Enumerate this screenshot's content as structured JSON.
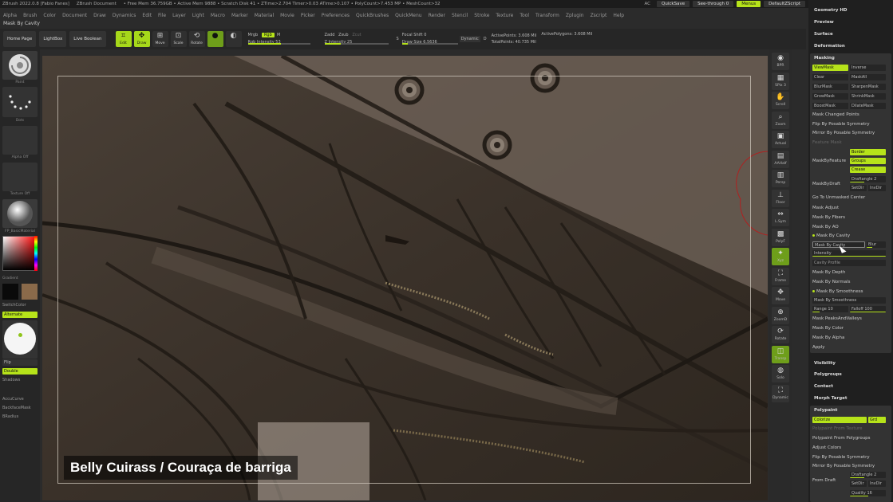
{
  "titlebar": {
    "app": "ZBrush 2022.0.8 [Fabio Fanes]",
    "doc": "ZBrush Document",
    "stats": "• Free Mem 36.759GB • Active Mem 9888 • Scratch Disk 41 • ZTime>2.704 Timer>0.03 ATime>0.107 • PolyCount>7.453 MP • MeshCount>32",
    "ac": "AC",
    "quicksave": "QuickSave",
    "seethrough": "See-through  0",
    "menus": "Menus",
    "zscript": "DefaultZScript"
  },
  "menu": [
    "Alpha",
    "Brush",
    "Color",
    "Document",
    "Draw",
    "Dynamics",
    "Edit",
    "File",
    "Layer",
    "Light",
    "Macro",
    "Marker",
    "Material",
    "Movie",
    "Picker",
    "Preferences",
    "QuickBrushes",
    "QuickMenu",
    "Render",
    "Stencil",
    "Stroke",
    "Texture",
    "Tool",
    "Transform",
    "Zplugin",
    "Zscript",
    "Help"
  ],
  "subtitle": "Mask By Cavity",
  "toolbar": {
    "home": "Home Page",
    "lightbox": "LightBox",
    "livebool": "Live Boolean",
    "edit": "Edit",
    "draw": "Draw",
    "move": "Move",
    "scale": "Scale",
    "rotate": "Rotate",
    "mrgb": "Mrgb",
    "rgb": "Rgb",
    "m": "M",
    "rgb_int": "Rgb Intensity 53",
    "zadd": "Zadd",
    "zsub": "Zsub",
    "zcut": "Zcut",
    "z_int": "Z Intensity 25",
    "focal": "Focal Shift 0",
    "drawsize": "Draw Size 6.5636",
    "dynamic": "Dynamic",
    "s_lbl": "S",
    "d_lbl": "D",
    "activepoints": "ActivePoints: 3.608 Mil",
    "totalpoints": "TotalPoints: 40.735 Mil",
    "activepolys": "ActivePolygons: 3.608 Mil",
    "rgb_val": 0.53,
    "z_val": 0.25,
    "focal_val": 0.5,
    "drawsize_val": 0.1
  },
  "left": {
    "paint": "Paint",
    "dots": "Dots",
    "alpha": "Alpha Off",
    "texture": "Texture Off",
    "material": "FP_BasicMaterial",
    "gradient": "Gradient",
    "switchcolor": "SwitchColor",
    "alternate": "Alternate",
    "flip": "Flip",
    "double": "Double",
    "shadows": "Shadows",
    "accucurve": "AccuCurve",
    "backface": "BackfaceMask",
    "bradius": "BRadius"
  },
  "caption": "Belly Cuirass / Couraça de barriga",
  "righttools": [
    {
      "label": "BPR",
      "icon": "bpr-icon"
    },
    {
      "label": "SPix 3",
      "icon": "spix-icon"
    },
    {
      "label": "Scroll",
      "icon": "scroll-icon"
    },
    {
      "label": "Zoom",
      "icon": "zoom-icon"
    },
    {
      "label": "Actual",
      "icon": "actual-icon"
    },
    {
      "label": "AAHalf",
      "icon": "aahalf-icon"
    },
    {
      "label": "Persp",
      "icon": "persp-icon"
    },
    {
      "label": "Floor",
      "icon": "floor-icon"
    },
    {
      "label": "L.Sym",
      "icon": "lsym-icon"
    },
    {
      "label": "PolyF",
      "icon": "polyf-icon"
    },
    {
      "label": "Xyz",
      "icon": "xyz-icon"
    },
    {
      "label": "Frame",
      "icon": "frame-icon"
    },
    {
      "label": "Move",
      "icon": "move-icon"
    },
    {
      "label": "ZoomD",
      "icon": "zoomd-icon"
    },
    {
      "label": "Rotate",
      "icon": "rotate-icon"
    },
    {
      "label": "Transp",
      "icon": "transp-icon"
    },
    {
      "label": "Solo",
      "icon": "solo-icon"
    },
    {
      "label": "Dynamic",
      "icon": "dynamic-icon"
    }
  ],
  "palette": {
    "top": [
      "Geometry HD",
      "Preview",
      "Surface",
      "Deformation"
    ],
    "masking": "Masking",
    "viewmask": "ViewMask",
    "inverse": "Inverse",
    "clear": "Clear",
    "maskall": "MaskAll",
    "blurmask": "BlurMask",
    "sharpenmask": "SharpenMask",
    "growmask": "GrowMask",
    "shrinkmask": "ShrinkMask",
    "boostmask": "BoostMask",
    "dilatemask": "DilateMask",
    "changed": "Mask Changed Points",
    "flip_sym": "Flip By Posable Symmetry",
    "mirror_sym": "Mirror By Posable Symmetry",
    "feature_mask": "Feature Mask",
    "maskbyfeature": "MaskByFeature",
    "border": "Border",
    "groups": "Groups",
    "crease": "Crease",
    "maskbydraft": "MaskByDraft",
    "draftangle": "Draftangle 2",
    "setdir": "SetDir",
    "invdir": "InvDir",
    "unmasked": "Go To Unmasked Center",
    "adjust": "Mask Adjust",
    "fibers": "Mask By Fibers",
    "ao": "Mask By AO",
    "cavity_head": "Mask By Cavity",
    "cavity_btn": "Mask By Cavity",
    "blur": "Blur",
    "intensity": "Intensity",
    "cavity_profile": "Cavity Profile",
    "depth": "Mask By Depth",
    "normals": "Mask By Normals",
    "smooth_head": "Mask By Smoothness",
    "smooth_btn": "Mask By Smoothness",
    "range": "Range 10",
    "falloff": "Falloff 100",
    "peaks": "Mask PeaksAndValleys",
    "color": "Mask By Color",
    "alpha": "Mask By Alpha",
    "apply": "Apply",
    "mid": [
      "Visibility",
      "Polygroups",
      "Contact",
      "Morph Target"
    ],
    "polypaint": "Polypaint",
    "colorize": "Colorize",
    "grd": "Grd",
    "pp_texture": "Polypaint From Texture",
    "pp_groups": "Polypaint From Polygroups",
    "adjust_colors": "Adjust Colors",
    "pp_flip": "Flip By Posable Symmetry",
    "pp_mirror": "Mirror By Posable Symmetry",
    "from_draft": "From Draft",
    "pp_draftangle": "Draftangle 2",
    "pp_setdir": "SetDir",
    "pp_invdir": "InvDir",
    "quality": "Quality 16"
  }
}
